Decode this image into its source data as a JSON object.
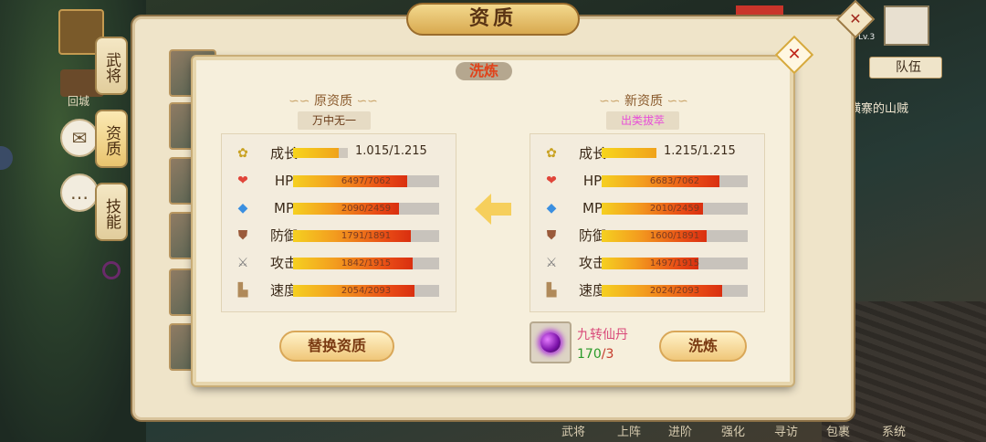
{
  "window": {
    "title": "资质"
  },
  "sidebar": {
    "tabs": [
      {
        "label": "武将"
      },
      {
        "label": "资质"
      },
      {
        "label": "技能"
      }
    ]
  },
  "left_icons": {
    "home_label": "回城"
  },
  "right_hud": {
    "level": "Lv.3",
    "team_label": "队伍",
    "quest_text": "横寨的山贼"
  },
  "bottom_nav": [
    "武将",
    "上阵",
    "进阶",
    "强化",
    "寻访",
    "包裹",
    "系统"
  ],
  "modal": {
    "title": "洗炼",
    "original": {
      "heading": "原资质",
      "grade": "万中无一",
      "grade_color": "#6b3d1a",
      "stats": [
        {
          "icon": "growth-icon",
          "name": "成长",
          "text": "1.015/1.215",
          "fraction": 0.835
        },
        {
          "icon": "heart-icon",
          "name": "HP",
          "text": "6497/7062",
          "fraction": 0.92
        },
        {
          "icon": "crystal-icon",
          "name": "MP",
          "text": "2090/2459",
          "fraction": 0.85
        },
        {
          "icon": "shield-icon",
          "name": "防御",
          "text": "1791/1891",
          "fraction": 0.947
        },
        {
          "icon": "sword-icon",
          "name": "攻击",
          "text": "1842/1915",
          "fraction": 0.962
        },
        {
          "icon": "boot-icon",
          "name": "速度",
          "text": "2054/2093",
          "fraction": 0.981
        }
      ],
      "button_label": "替换资质"
    },
    "new": {
      "heading": "新资质",
      "grade": "出类拔萃",
      "grade_color": "#e84fd8",
      "stats": [
        {
          "icon": "growth-icon",
          "name": "成长",
          "text": "1.215/1.215",
          "fraction": 1.0
        },
        {
          "icon": "heart-icon",
          "name": "HP",
          "text": "6683/7062",
          "fraction": 0.946
        },
        {
          "icon": "crystal-icon",
          "name": "MP",
          "text": "2010/2459",
          "fraction": 0.817
        },
        {
          "icon": "shield-icon",
          "name": "防御",
          "text": "1600/1891",
          "fraction": 0.846
        },
        {
          "icon": "sword-icon",
          "name": "攻击",
          "text": "1497/1915",
          "fraction": 0.782
        },
        {
          "icon": "boot-icon",
          "name": "速度",
          "text": "2024/2093",
          "fraction": 0.967
        }
      ],
      "button_label": "洗炼"
    },
    "item": {
      "name": "九转仙丹",
      "owned": "170",
      "cost": "/3"
    }
  }
}
